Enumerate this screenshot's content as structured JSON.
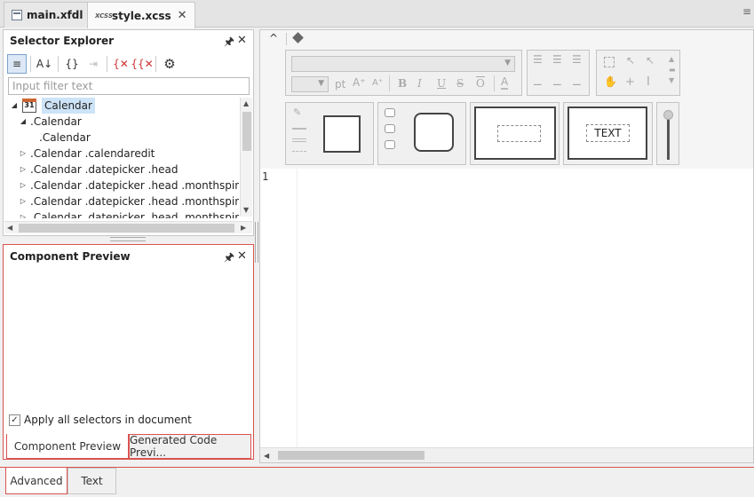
{
  "tabs": [
    {
      "label": "main.xfdl",
      "icon": "form-file-icon"
    },
    {
      "label": "style.xcss",
      "icon": "xcss-file-icon"
    }
  ],
  "xcss_icon_text": "XCSS",
  "explorer": {
    "title": "Selector Explorer",
    "filter_placeholder": "Input filter text",
    "calendar_day": "31",
    "toolbar": [
      {
        "name": "style-list-icon",
        "glyph": "≡",
        "active": true
      },
      {
        "name": "sort-az-icon",
        "glyph": "A↓",
        "active": false
      },
      {
        "name": "add-selector-icon",
        "glyph": "{}",
        "active": false
      },
      {
        "name": "add-child-icon",
        "glyph": "⇥",
        "active": false
      },
      {
        "name": "delete-selector-icon",
        "glyph": "{✕",
        "active": false
      },
      {
        "name": "delete-all-icon",
        "glyph": "{{✕",
        "active": false
      },
      {
        "name": "settings-gear-icon",
        "glyph": "⚙",
        "active": false
      }
    ],
    "tree": [
      {
        "text": "Calendar",
        "level": 0,
        "twisty": "◢",
        "selected": true,
        "calendar_icon": true
      },
      {
        "text": ".Calendar",
        "level": 1,
        "twisty": "◢",
        "selected": false
      },
      {
        "text": ".Calendar",
        "level": 2,
        "twisty": "",
        "selected": false
      },
      {
        "text": ".Calendar .calendaredit",
        "level": 1,
        "twisty": "▷",
        "selected": false
      },
      {
        "text": ".Calendar .datepicker .head",
        "level": 1,
        "twisty": "▷",
        "selected": false
      },
      {
        "text": ".Calendar .datepicker .head .monthspin",
        "level": 1,
        "twisty": "▷",
        "selected": false
      },
      {
        "text": ".Calendar .datepicker .head .monthspin .spin",
        "level": 1,
        "twisty": "▷",
        "selected": false
      },
      {
        "text": ".Calendar .datepicker .head .monthspin .spin",
        "level": 1,
        "twisty": "▷",
        "selected": false
      }
    ]
  },
  "preview": {
    "title": "Component Preview",
    "apply_label": "Apply all selectors in document",
    "apply_checked": true,
    "tabs": [
      "Component Preview",
      "Generated Code Previ..."
    ]
  },
  "editor": {
    "font_unit": "pt",
    "line_number": "1",
    "text_preview": "TEXT",
    "format_glyphs": [
      "B",
      "I",
      "U",
      "S",
      "O"
    ]
  },
  "bottom_tabs": [
    "Advanced",
    "Text"
  ],
  "pin_glyph": "🖈",
  "close_glyph": "✕",
  "chevron_glyph": "^",
  "menu_glyph": "≡",
  "colors": {
    "accent_red": "#d9534f",
    "selection": "#cde3f7"
  }
}
